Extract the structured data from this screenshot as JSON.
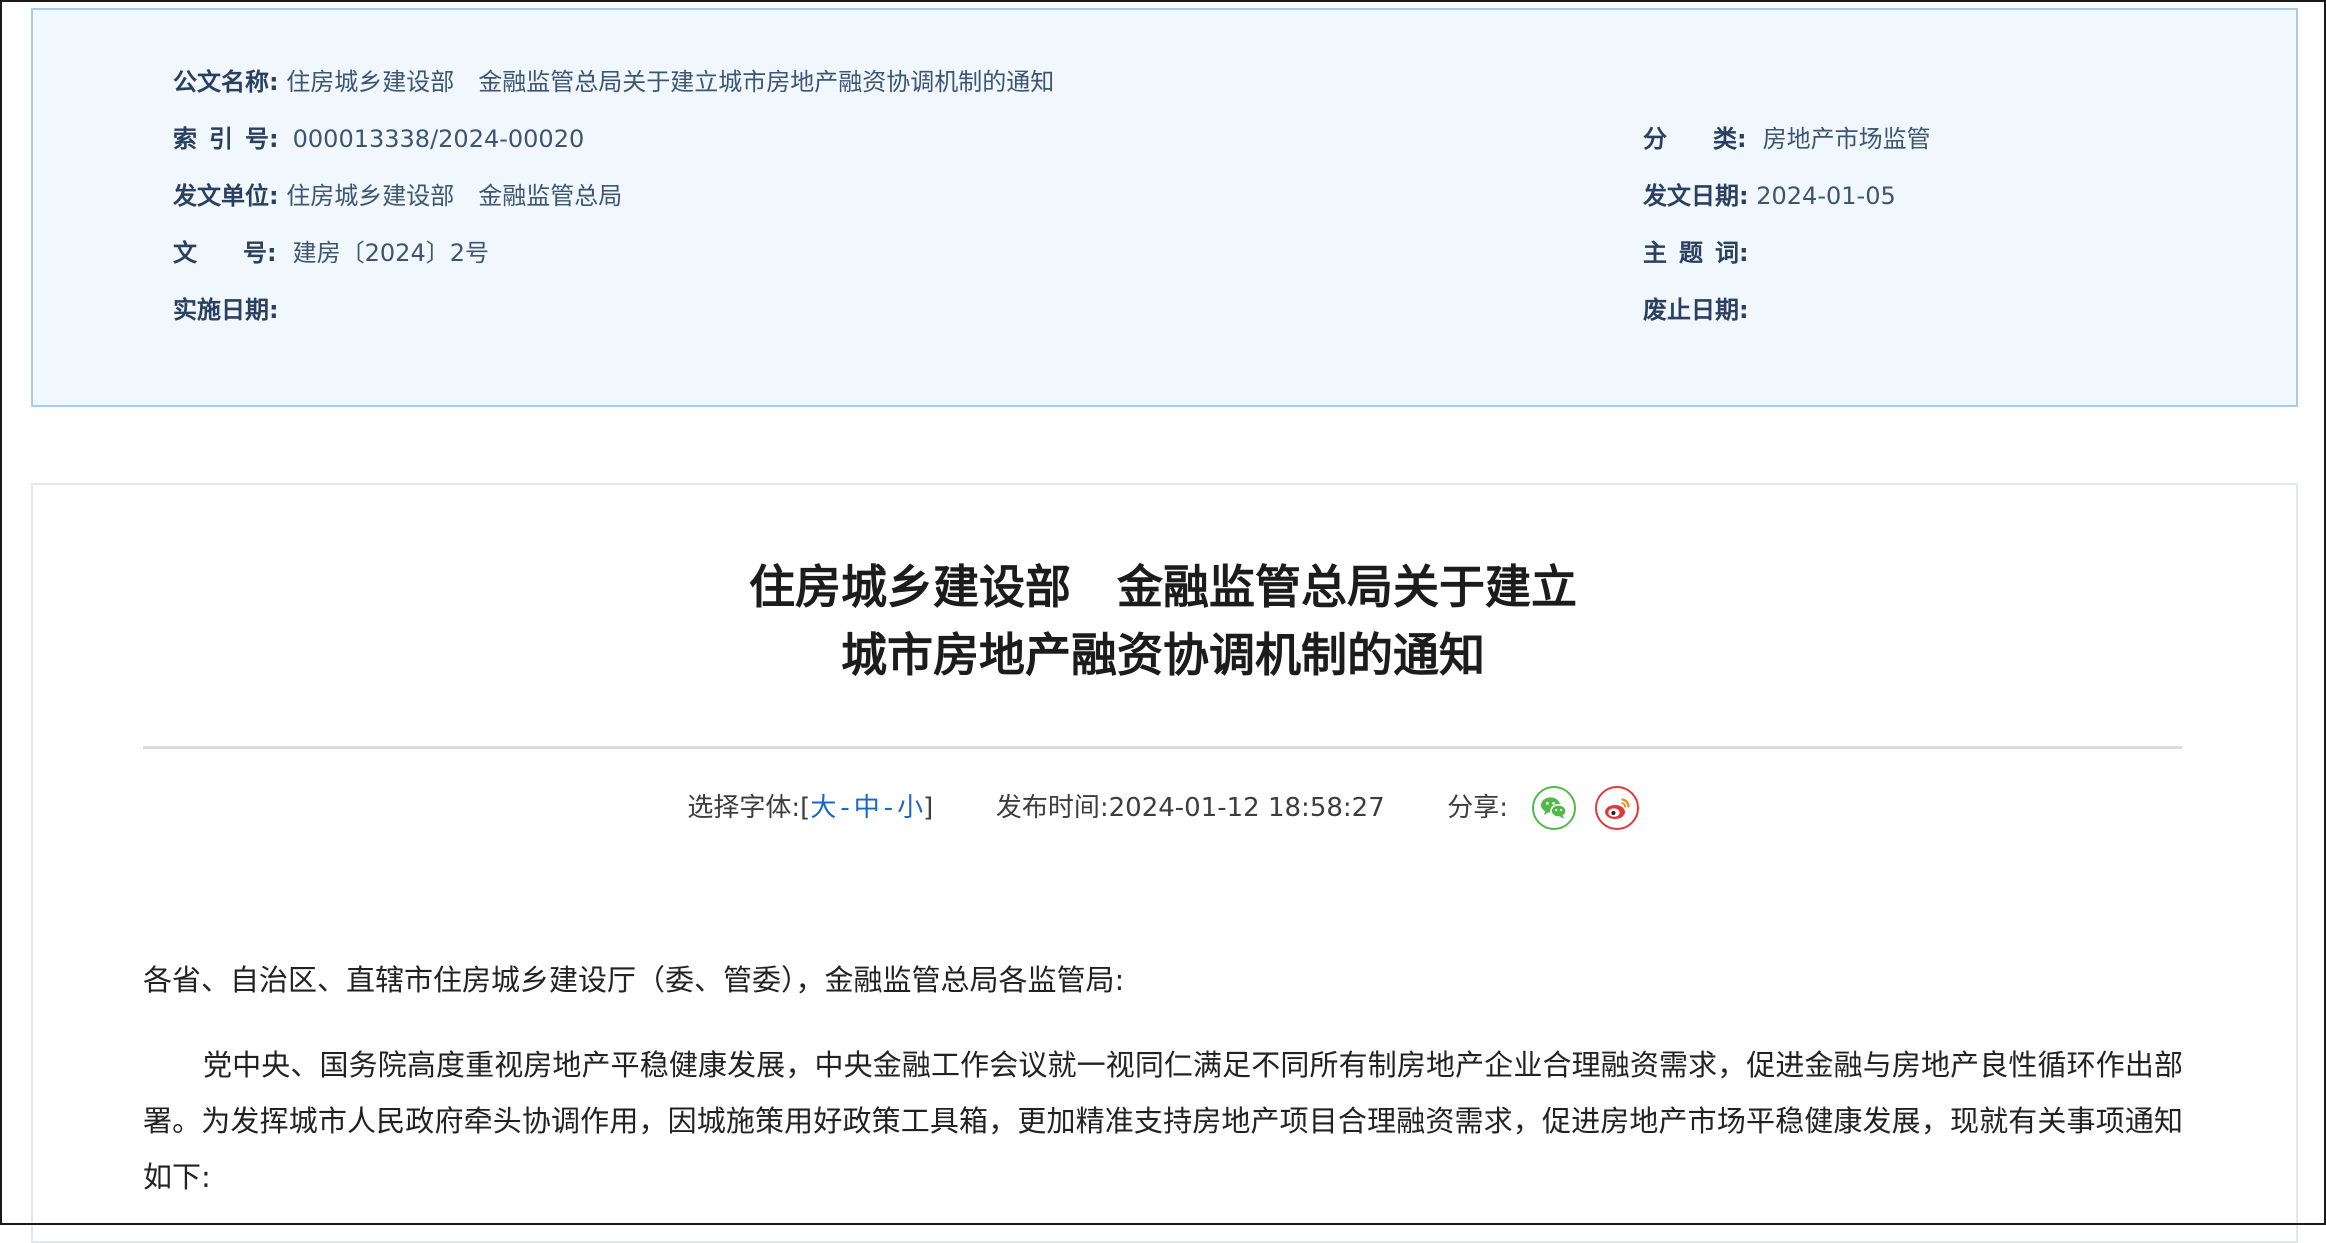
{
  "meta": {
    "doc_name_label": "公文名称:",
    "doc_name_value": "住房城乡建设部　金融监管总局关于建立城市房地产融资协调机制的通知",
    "index_label_chars": [
      "索",
      "引",
      "号:"
    ],
    "index_value": "000013338/2024-00020",
    "category_label_chars": [
      "分",
      "类:"
    ],
    "category_value": "房地产市场监管",
    "issuer_label": "发文单位:",
    "issuer_value": "住房城乡建设部　金融监管总局",
    "issue_date_label": "发文日期:",
    "issue_date_value": "2024-01-05",
    "doc_number_label_chars": [
      "文",
      "号:"
    ],
    "doc_number_value": "建房〔2024〕2号",
    "keywords_label_chars": [
      "主",
      "题",
      "词:"
    ],
    "keywords_value": "",
    "effective_date_label": "实施日期:",
    "effective_date_value": "",
    "expiry_date_label": "废止日期:",
    "expiry_date_value": ""
  },
  "article": {
    "title_line1": "住房城乡建设部　金融监管总局关于建立",
    "title_line2": "城市房地产融资协调机制的通知",
    "font_select_label": "选择字体:",
    "bracket_open": "[",
    "font_large": "大",
    "font_medium": "中",
    "font_small": "小",
    "font_sep": "-",
    "bracket_close": "]",
    "publish_time_label": "发布时间:",
    "publish_time_value": "2024-01-12 18:58:27",
    "share_label": "分享:",
    "salutation": "各省、自治区、直辖市住房城乡建设厅（委、管委），金融监管总局各监管局:",
    "paragraph1": "党中央、国务院高度重视房地产平稳健康发展，中央金融工作会议就一视同仁满足不同所有制房地产企业合理融资需求，促进金融与房地产良性循环作出部署。为发挥城市人民政府牵头协调作用，因城施策用好政策工具箱，更加精准支持房地产项目合理融资需求，促进房地产市场平稳健康发展，现就有关事项通知如下:"
  },
  "icons": {
    "share_wechat": "wechat-icon",
    "share_weibo": "weibo-icon"
  },
  "colors": {
    "panel_bg": "#f1f8fd",
    "panel_border": "#a8cce6",
    "link_blue": "#1a67c9",
    "wechat_green": "#52b948",
    "weibo_red": "#e0393b"
  }
}
